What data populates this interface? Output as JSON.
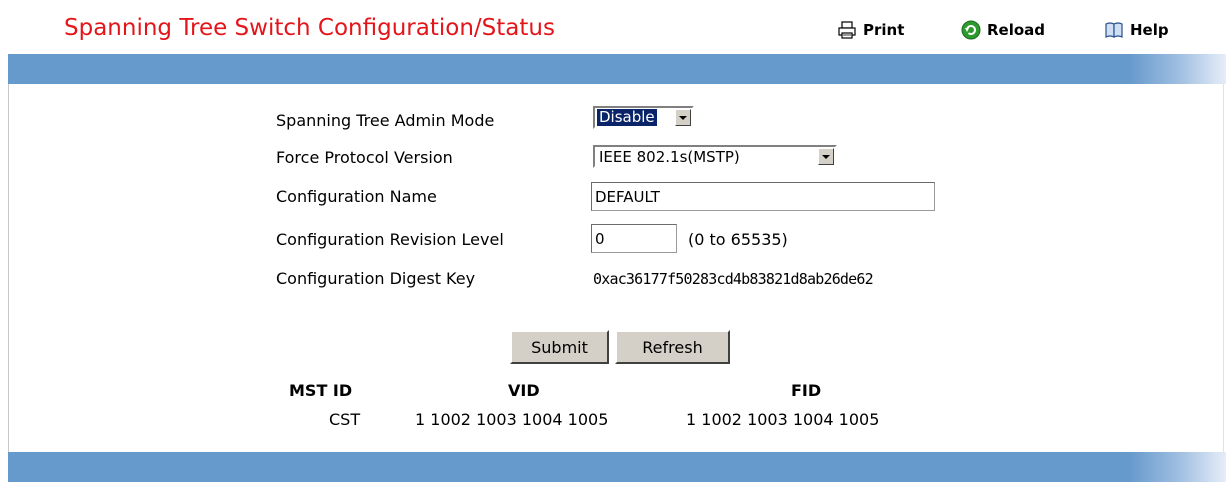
{
  "header": {
    "title": "Spanning Tree Switch Configuration/Status",
    "print_label": "Print",
    "reload_label": "Reload",
    "help_label": "Help"
  },
  "form": {
    "admin_mode": {
      "label": "Spanning Tree Admin Mode",
      "value": "Disable"
    },
    "force_protocol": {
      "label": "Force Protocol Version",
      "value": "IEEE 802.1s(MSTP)"
    },
    "config_name": {
      "label": "Configuration Name",
      "value": "DEFAULT"
    },
    "revision_level": {
      "label": "Configuration Revision Level",
      "value": "0",
      "range": "(0 to 65535)"
    },
    "digest_key": {
      "label": "Configuration Digest Key",
      "value": "0xac36177f50283cd4b83821d8ab26de62"
    }
  },
  "buttons": {
    "submit": "Submit",
    "refresh": "Refresh"
  },
  "table": {
    "headers": [
      "MST ID",
      "VID",
      "FID"
    ],
    "rows": [
      [
        "CST",
        "1 1002 1003 1004 1005",
        "1 1002 1003 1004 1005"
      ]
    ]
  },
  "colors": {
    "title": "#e4151a",
    "band": "#6699cc"
  }
}
